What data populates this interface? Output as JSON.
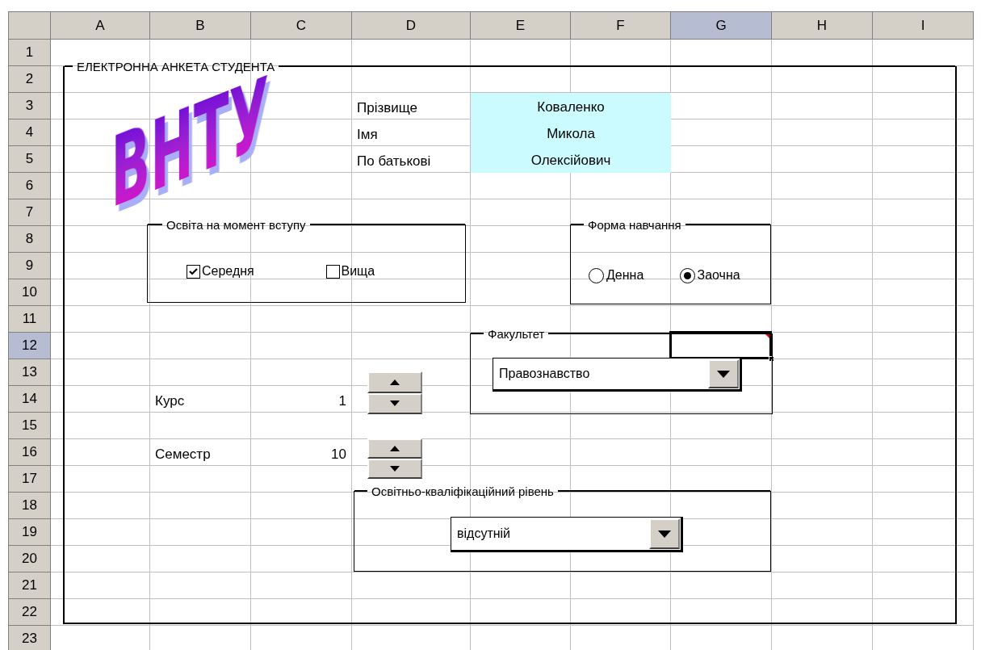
{
  "sheet": {
    "columns": [
      {
        "label": "A",
        "selected": false
      },
      {
        "label": "B",
        "selected": false
      },
      {
        "label": "C",
        "selected": false
      },
      {
        "label": "D",
        "selected": false
      },
      {
        "label": "E",
        "selected": false
      },
      {
        "label": "F",
        "selected": false
      },
      {
        "label": "G",
        "selected": true
      },
      {
        "label": "H",
        "selected": false
      },
      {
        "label": "I",
        "selected": false
      }
    ],
    "rows": [
      {
        "label": "1",
        "selected": false
      },
      {
        "label": "2",
        "selected": false
      },
      {
        "label": "3",
        "selected": false
      },
      {
        "label": "4",
        "selected": false
      },
      {
        "label": "5",
        "selected": false
      },
      {
        "label": "6",
        "selected": false
      },
      {
        "label": "7",
        "selected": false
      },
      {
        "label": "8",
        "selected": false
      },
      {
        "label": "9",
        "selected": false
      },
      {
        "label": "10",
        "selected": false
      },
      {
        "label": "11",
        "selected": false
      },
      {
        "label": "12",
        "selected": true
      },
      {
        "label": "13",
        "selected": false
      },
      {
        "label": "14",
        "selected": false
      },
      {
        "label": "15",
        "selected": false
      },
      {
        "label": "16",
        "selected": false
      },
      {
        "label": "17",
        "selected": false
      },
      {
        "label": "18",
        "selected": false
      },
      {
        "label": "19",
        "selected": false
      },
      {
        "label": "20",
        "selected": false
      },
      {
        "label": "21",
        "selected": false
      },
      {
        "label": "22",
        "selected": false
      },
      {
        "label": "23",
        "selected": false
      }
    ]
  },
  "form": {
    "title": "ЕЛЕКТРОННА АНКЕТА СТУДЕНТА",
    "logo": "ВНТУ",
    "fields": [
      {
        "label": "Прізвище",
        "value": "Коваленко"
      },
      {
        "label": "Імя",
        "value": "Микола"
      },
      {
        "label": "По батькові",
        "value": "Олексійович"
      }
    ],
    "education": {
      "title": "Освіта на момент вступу",
      "options": [
        {
          "label": "Середня",
          "checked": true
        },
        {
          "label": "Вища",
          "checked": false
        }
      ]
    },
    "study_form": {
      "title": "Форма навчання",
      "options": [
        {
          "label": "Денна",
          "selected": false
        },
        {
          "label": "Заочна",
          "selected": true
        }
      ]
    },
    "faculty": {
      "title": "Факультет",
      "value": "Правознавство"
    },
    "spinners": [
      {
        "label": "Курс",
        "value": "1"
      },
      {
        "label": "Семестр",
        "value": "10"
      }
    ],
    "qualification": {
      "title": "Освітньо-кваліфікаційний рівень",
      "value": "відсутній"
    }
  }
}
